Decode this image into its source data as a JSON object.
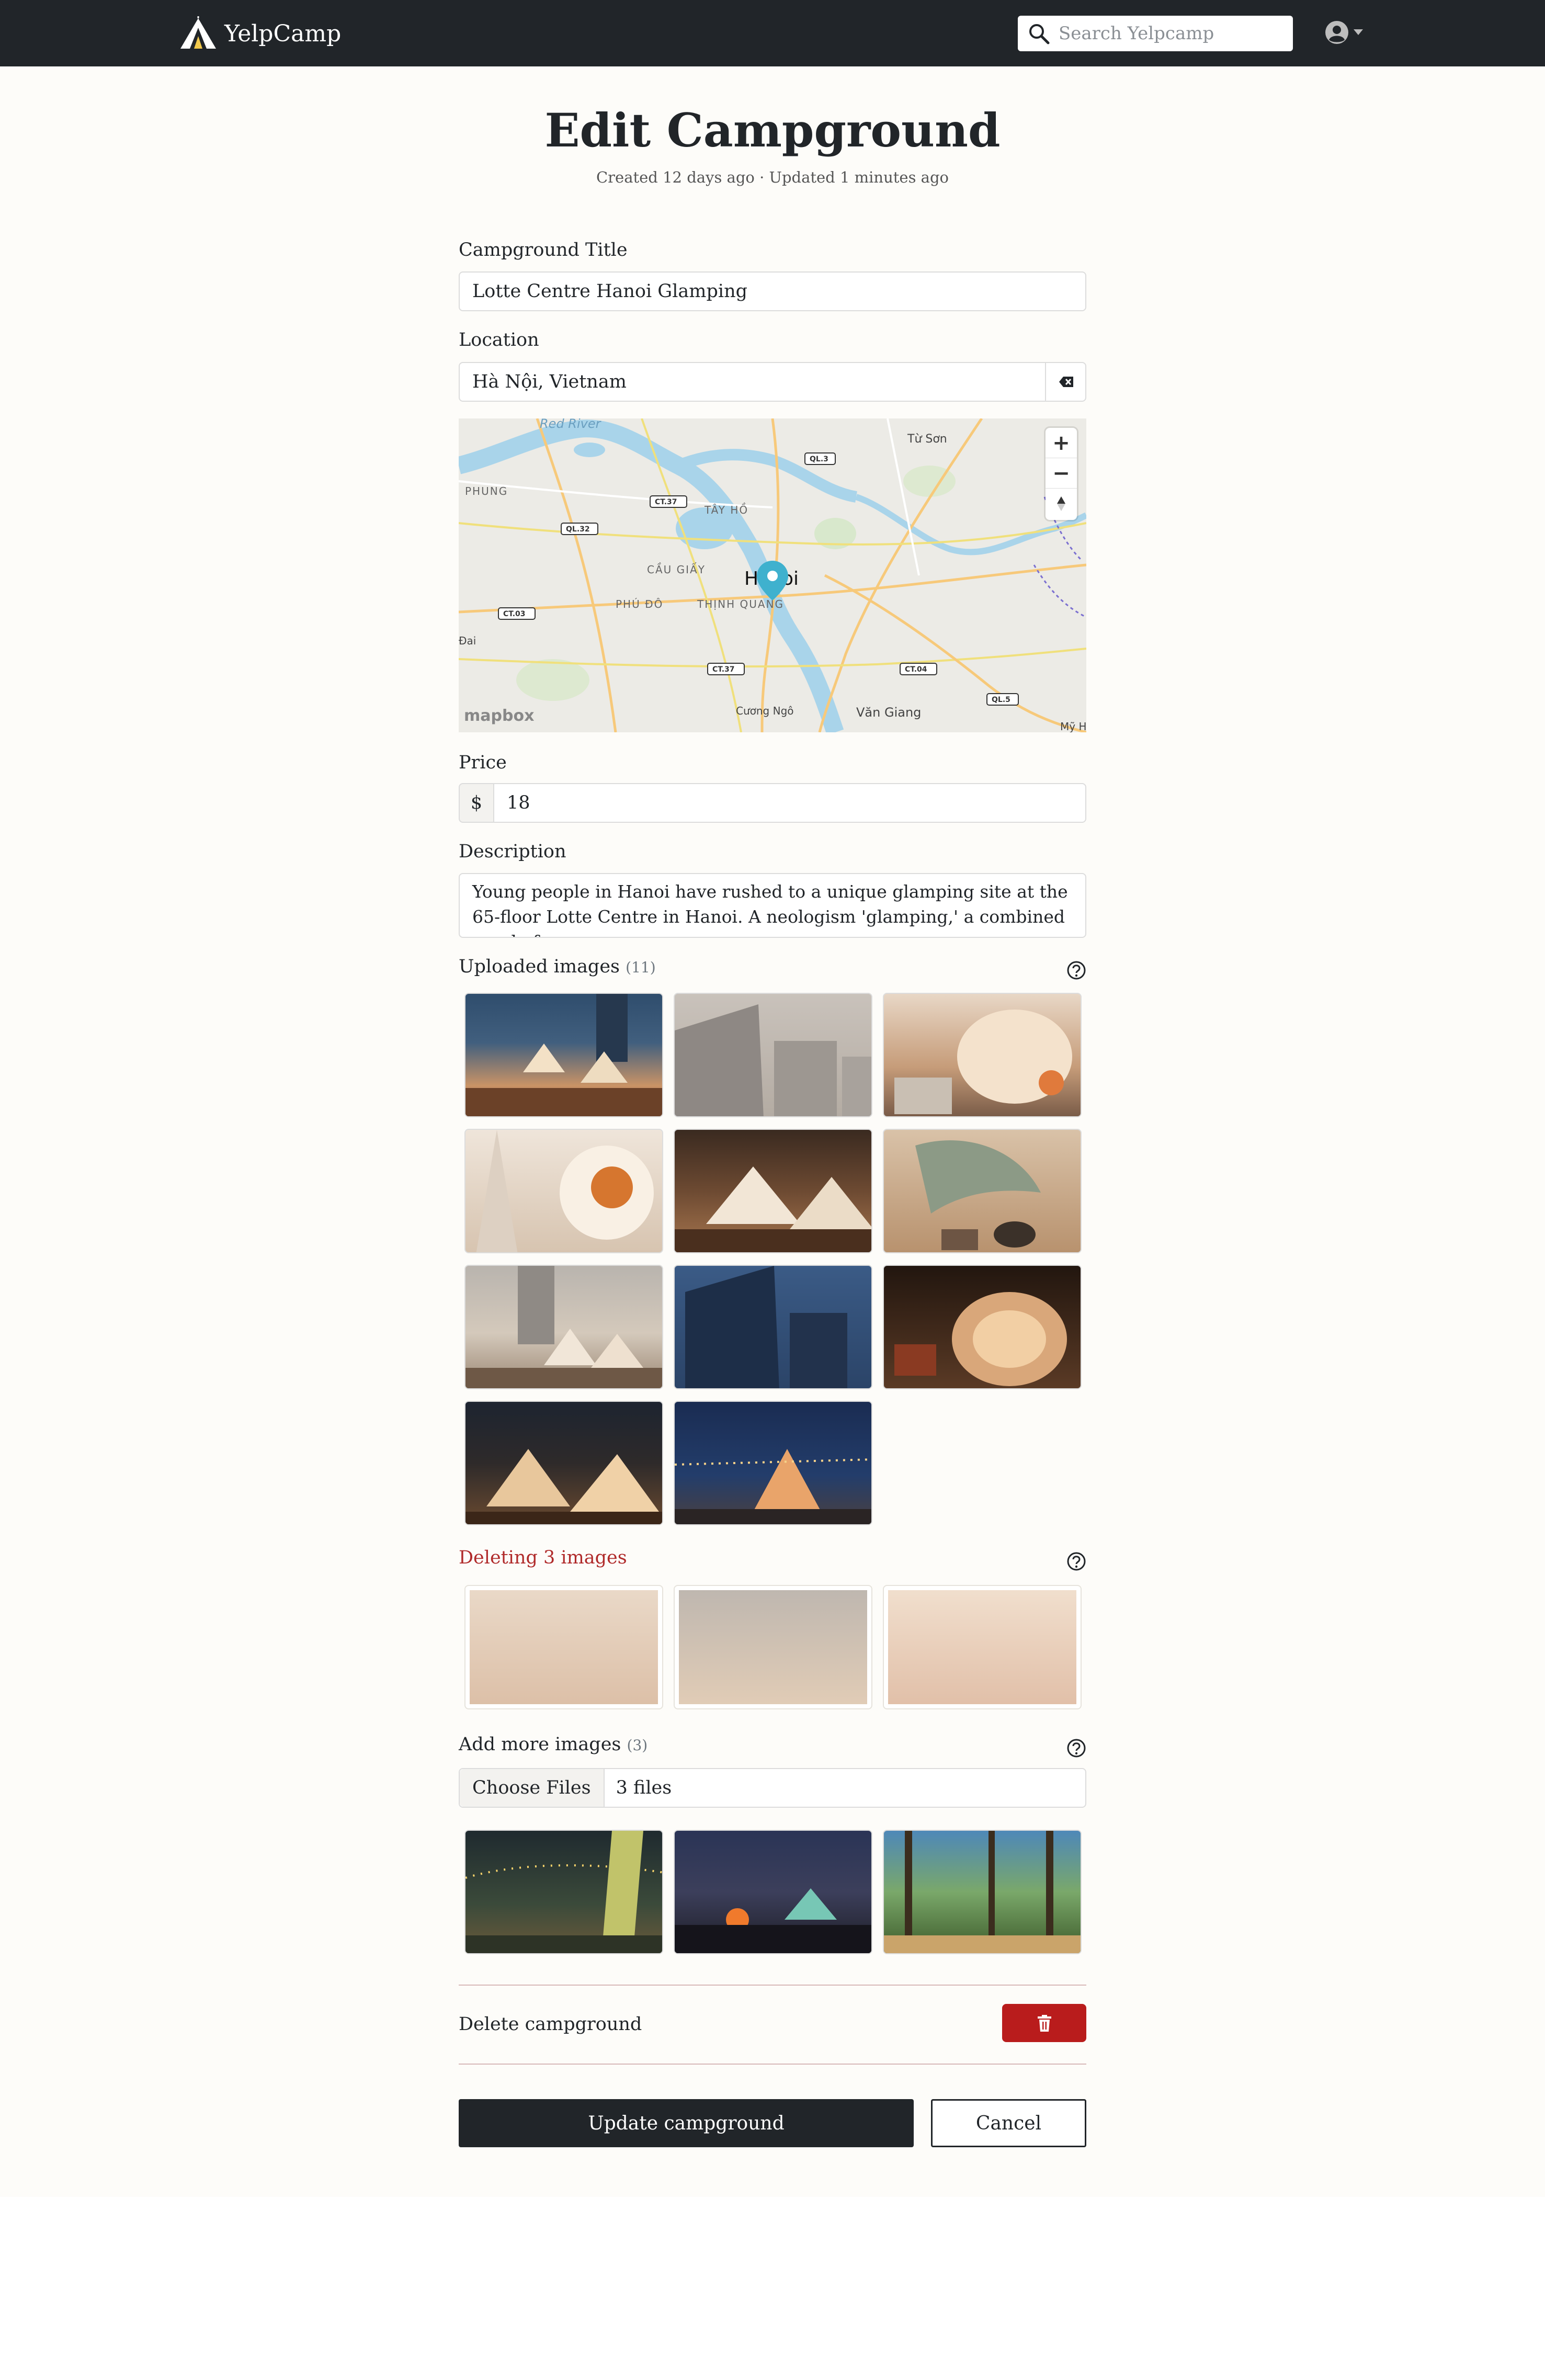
{
  "navbar": {
    "brand": "YelpCamp",
    "search_placeholder": "Search Yelpcamp"
  },
  "page": {
    "title": "Edit Campground",
    "meta": "Created 12 days ago · Updated 1 minutes ago"
  },
  "form": {
    "title_label": "Campground Title",
    "title_value": "Lotte Centre Hanoi Glamping",
    "location_label": "Location",
    "location_value": "Hà Nội, Vietnam",
    "price_label": "Price",
    "currency": "$",
    "price_value": "18",
    "description_label": "Description",
    "description_value": "Young people in Hanoi have rushed to a unique glamping site at the 65-floor Lotte Centre in Hanoi. A neologism 'glamping,' a combined word of"
  },
  "map": {
    "center_label": "Hanoi",
    "logo": "mapbox",
    "places": [
      "Red River",
      "Từ Sơn",
      "PHUNG",
      "TÂY HỒ",
      "CẦU GIẤY",
      "PHÚ ĐÔ",
      "THỊNH QUANG",
      "Cương Ngô",
      "Văn Giang",
      "Mỹ H",
      "Đai"
    ],
    "roads": [
      "QL.3",
      "CT.37",
      "QL.32",
      "CT.03",
      "CT.37",
      "CT.04",
      "QL.5"
    ]
  },
  "uploaded": {
    "title": "Uploaded images",
    "count": "(11)"
  },
  "deleting": {
    "title": "Deleting 3 images"
  },
  "add_more": {
    "title": "Add more images",
    "count": "(3)",
    "choose_label": "Choose Files",
    "files_text": "3 files"
  },
  "danger": {
    "delete_label": "Delete campground"
  },
  "actions": {
    "update": "Update campground",
    "cancel": "Cancel"
  },
  "colors": {
    "navbar": "#212529",
    "danger": "#b91c1c",
    "background": "#fdfcf9"
  }
}
